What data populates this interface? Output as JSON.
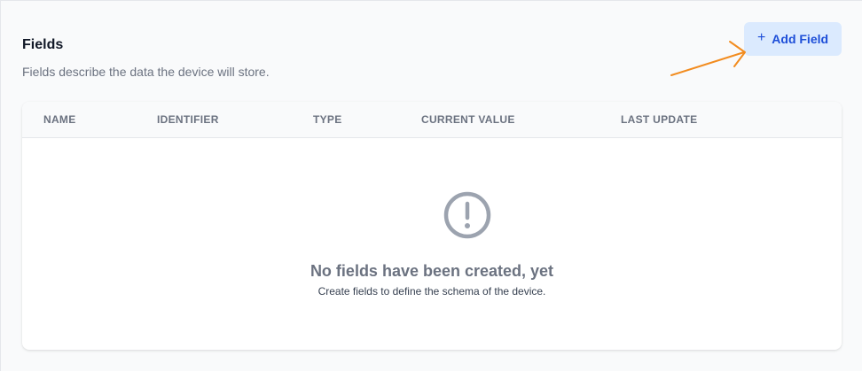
{
  "section": {
    "title": "Fields",
    "description": "Fields describe the data the device will store."
  },
  "add_button": {
    "icon": "plus-icon",
    "icon_glyph": "+",
    "label": "Add Field"
  },
  "table": {
    "columns": [
      "NAME",
      "IDENTIFIER",
      "TYPE",
      "CURRENT VALUE",
      "LAST UPDATE"
    ],
    "rows": []
  },
  "empty_state": {
    "icon": "exclamation-circle-icon",
    "title": "No fields have been created, yet",
    "description": "Create fields to define the schema of the device."
  },
  "annotation": {
    "icon": "arrow-icon",
    "color": "#f28c1f"
  },
  "colors": {
    "accent": "#1d4ed8",
    "accent_bg": "#dbeafe"
  }
}
